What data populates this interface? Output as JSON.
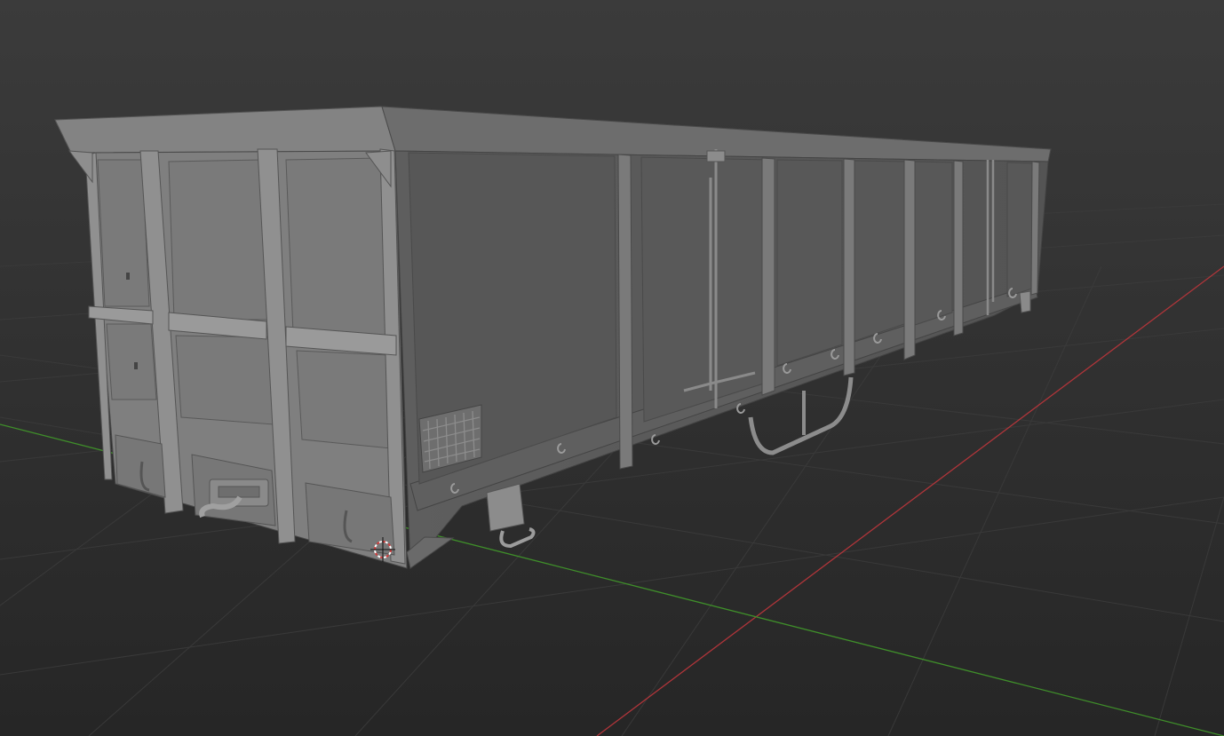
{
  "viewport": {
    "mode": "3d-viewport",
    "shading": "solid",
    "background_top": "#393939",
    "background_bottom": "#272727",
    "grid_color": "#3a3a3a",
    "x_axis_color": "#b0353a",
    "y_axis_color": "#3f8f2a"
  },
  "scene": {
    "object": "open-wagon-model",
    "cursor_icon": "3d-cursor-icon"
  }
}
